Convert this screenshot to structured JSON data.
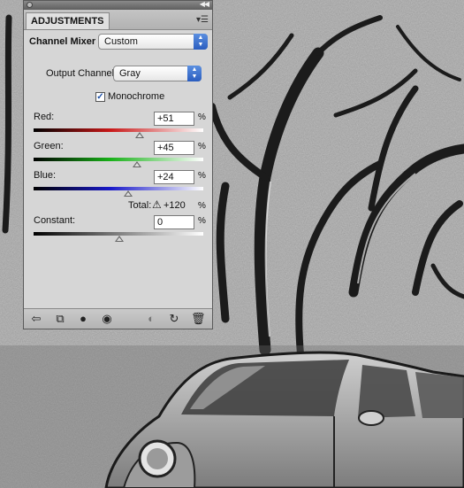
{
  "panel": {
    "tab_label": "ADJUSTMENTS",
    "adjustment_name": "Channel Mixer",
    "preset_value": "Custom",
    "output_channel_label": "Output Channel:",
    "output_channel_value": "Gray",
    "monochrome_label": "Monochrome",
    "monochrome_checked": true,
    "sliders": [
      {
        "label": "Red:",
        "value": "+51",
        "unit": "%"
      },
      {
        "label": "Green:",
        "value": "+45",
        "unit": "%"
      },
      {
        "label": "Blue:",
        "value": "+24",
        "unit": "%"
      }
    ],
    "total_label": "Total:",
    "total_value": "+120",
    "total_unit": "%",
    "constant_label": "Constant:",
    "constant_value": "0",
    "constant_unit": "%"
  },
  "icons": {
    "header": [
      "collapse-arrows-icon",
      "panel-menu-icon"
    ],
    "footer": [
      "back-arrow-icon",
      "expand-view-icon",
      "clip-to-layer-icon",
      "visibility-eye-icon",
      "view-previous-state-icon",
      "reset-icon",
      "trash-icon"
    ]
  }
}
